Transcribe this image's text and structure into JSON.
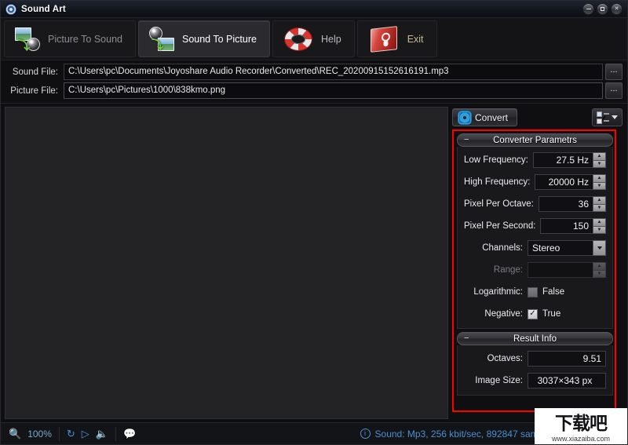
{
  "window": {
    "title": "Sound Art",
    "icon": "app-gear-icon",
    "controls": [
      {
        "name": "minimize",
        "glyph": "dash"
      },
      {
        "name": "maximize",
        "glyph": "square"
      },
      {
        "name": "close",
        "glyph": "✕"
      }
    ]
  },
  "toolbar": {
    "buttons": [
      {
        "label": "Picture To Sound",
        "icon": "picture-to-sound-icon",
        "active": false
      },
      {
        "label": "Sound To Picture",
        "icon": "sound-to-picture-icon",
        "active": true
      },
      {
        "label": "Help",
        "icon": "lifering-icon",
        "active": false
      },
      {
        "label": "Exit",
        "icon": "power-switch-icon",
        "active": false
      }
    ]
  },
  "files": {
    "sound": {
      "label": "Sound File:",
      "value": "C:\\Users\\pc\\Documents\\Joyoshare Audio Recorder\\Converted\\REC_20200915152616191.mp3",
      "browse_label": "..."
    },
    "picture": {
      "label": "Picture File:",
      "value": "C:\\Users\\pc\\Pictures\\1000\\838kmo.png",
      "browse_label": "..."
    }
  },
  "actions": {
    "convert_label": "Convert",
    "convert_icon": "gear-icon",
    "list_icon": "checklist-dropdown-icon"
  },
  "converter_panel": {
    "title": "Converter Parametrs",
    "collapse_glyph": "−",
    "fields": [
      {
        "label": "Low Frequency:",
        "value": "27.5 Hz",
        "type": "spinner",
        "disabled": false
      },
      {
        "label": "High Frequency:",
        "value": "20000 Hz",
        "type": "spinner",
        "disabled": false
      },
      {
        "label": "Pixel Per Octave:",
        "value": "36",
        "type": "spinner",
        "disabled": false
      },
      {
        "label": "Pixel Per Second:",
        "value": "150",
        "type": "spinner",
        "disabled": false
      },
      {
        "label": "Channels:",
        "value": "Stereo",
        "type": "combo",
        "disabled": false
      },
      {
        "label": "Range:",
        "value": "",
        "type": "spinner",
        "disabled": true
      }
    ],
    "checkboxes": [
      {
        "label": "Logarithmic:",
        "value": "False",
        "checked": false,
        "disabled": true
      },
      {
        "label": "Negative:",
        "value": "True",
        "checked": true,
        "disabled": false
      }
    ]
  },
  "result_panel": {
    "title": "Result Info",
    "collapse_glyph": "−",
    "fields": [
      {
        "label": "Octaves:",
        "value": "9.51"
      },
      {
        "label": "Image Size:",
        "value": "3037×343 px"
      }
    ]
  },
  "statusbar": {
    "zoom": "100%",
    "zoom_icon": "magnifier-icon",
    "playback_icons": [
      "loop-icon",
      "play-step-icon",
      "speaker-icon"
    ],
    "comment_icon": "comment-icon",
    "info_icon": "info-icon",
    "info_text": "Sound: Mp3, 256 kbit/sec, 892847 samples,"
  },
  "watermark": {
    "logo": "下载吧",
    "url": "www.xiazaiba.com"
  },
  "annotation": {
    "color": "#ff0000"
  }
}
